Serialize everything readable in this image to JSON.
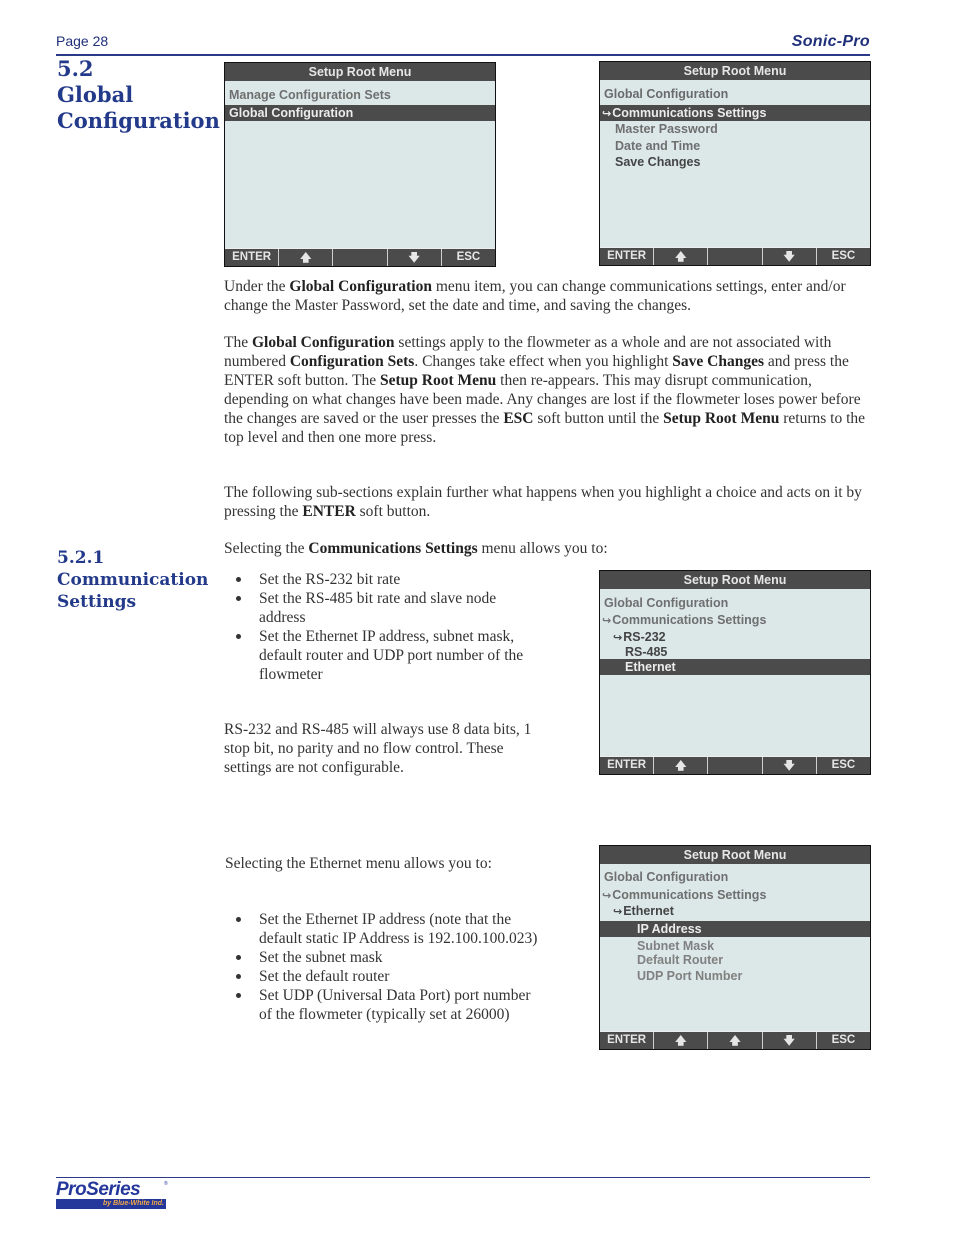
{
  "header": {
    "page": "Page 28",
    "brand": "Sonic-Pro"
  },
  "section": {
    "number": "5.2",
    "title_line1": "Global",
    "title_line2": "Configuration"
  },
  "subsection": {
    "number": "5.2.1",
    "title_line1": "Communication",
    "title_line2": "Settings"
  },
  "screens": [
    {
      "title": "Setup Root Menu",
      "rows": [
        {
          "text": "Manage Configuration Sets",
          "selected": false
        },
        {
          "text": "Global Configuration",
          "selected": true
        }
      ],
      "softkeys": [
        "ENTER",
        "up-arrow",
        "",
        "down-arrow",
        "ESC"
      ]
    },
    {
      "title": "Setup Root Menu",
      "rows": [
        {
          "text": "Global Configuration",
          "selected": false
        },
        {
          "text": "Communications Settings",
          "selected": true,
          "hook": true
        },
        {
          "text": "Master Password",
          "selected": false
        },
        {
          "text": "Date and Time",
          "selected": false
        },
        {
          "text": "Save Changes",
          "selected": false
        }
      ],
      "softkeys": [
        "ENTER",
        "up-arrow",
        "",
        "down-arrow",
        "ESC"
      ]
    },
    {
      "title": "Setup Root Menu",
      "rows": [
        {
          "text": "Global Configuration",
          "selected": false
        },
        {
          "text": "Communications Settings",
          "selected": false,
          "hook": true
        },
        {
          "text": "RS-232",
          "selected": false,
          "hook": true
        },
        {
          "text": "RS-485",
          "selected": false
        },
        {
          "text": "Ethernet",
          "selected": true
        }
      ],
      "softkeys": [
        "ENTER",
        "up-arrow",
        "",
        "down-arrow",
        "ESC"
      ]
    },
    {
      "title": "Setup Root Menu",
      "rows": [
        {
          "text": "Global Configuration",
          "selected": false
        },
        {
          "text": "Communications Settings",
          "selected": false,
          "hook": true
        },
        {
          "text": "Ethernet",
          "selected": false,
          "hook": true
        },
        {
          "text": "IP Address",
          "selected": true
        },
        {
          "text": "Subnet Mask",
          "selected": false
        },
        {
          "text": "Default Router",
          "selected": false
        },
        {
          "text": "UDP Port Number",
          "selected": false
        }
      ],
      "softkeys": [
        "ENTER",
        "up-arrow",
        "up-arrow",
        "down-arrow",
        "ESC"
      ]
    }
  ],
  "text": {
    "p1": {
      "a": "Under the ",
      "b1": "Global Configuration",
      "c": " menu item, you can change communications settings, enter and/or change the Master Password, set the date and time, and saving the changes."
    },
    "p2": {
      "a": "The ",
      "b1": "Global Configuration",
      "c": " settings apply to the flowmeter as a whole and are not associated with numbered ",
      "b2": "Configuration Sets",
      "d": ". Changes take effect when you highlight ",
      "b3": "Save Changes",
      "e": " and press the ENTER soft button. The ",
      "b4": "Setup Root Menu",
      "f": " then re-appears. This may disrupt communication, depending on what changes have been made. Any changes are lost if the flowmeter loses power before the changes are saved or the user presses the ",
      "b5": "ESC",
      "g": " soft button until the ",
      "b6": "Setup Root Menu",
      "h": " returns to the top level and then one more press."
    },
    "p3": {
      "a": "The following sub-sections explain further what happens when you highlight a choice and acts on it by pressing the ",
      "b1": "ENTER",
      "c": " soft button."
    },
    "p4": {
      "a": "Selecting the ",
      "b1": "Communications Settings",
      "c": " menu allows you to:"
    },
    "comm_bullets": [
      "Set the RS-232 bit rate",
      "Set the RS-485 bit rate and slave node address",
      "Set the Ethernet IP address, subnet mask, default router and UDP port number of the flowmeter"
    ],
    "p5": "RS-232 and RS-485 will always use 8 data bits, 1 stop bit, no parity and no flow control. These settings are not configurable.",
    "p6": "Selecting the Ethernet menu allows you to:",
    "eth_bullets": [
      "Set the Ethernet IP address (note that the default static IP Address is 192.100.100.023)",
      "Set the subnet mask",
      "Set the default router",
      "Set UDP (Universal Data Port) port number of the flowmeter (typically set at 26000)"
    ]
  },
  "footer": {
    "logo_word": "ProSeries",
    "logo_tag": "by Blue-White Ind.",
    "logo_mark": "®"
  }
}
